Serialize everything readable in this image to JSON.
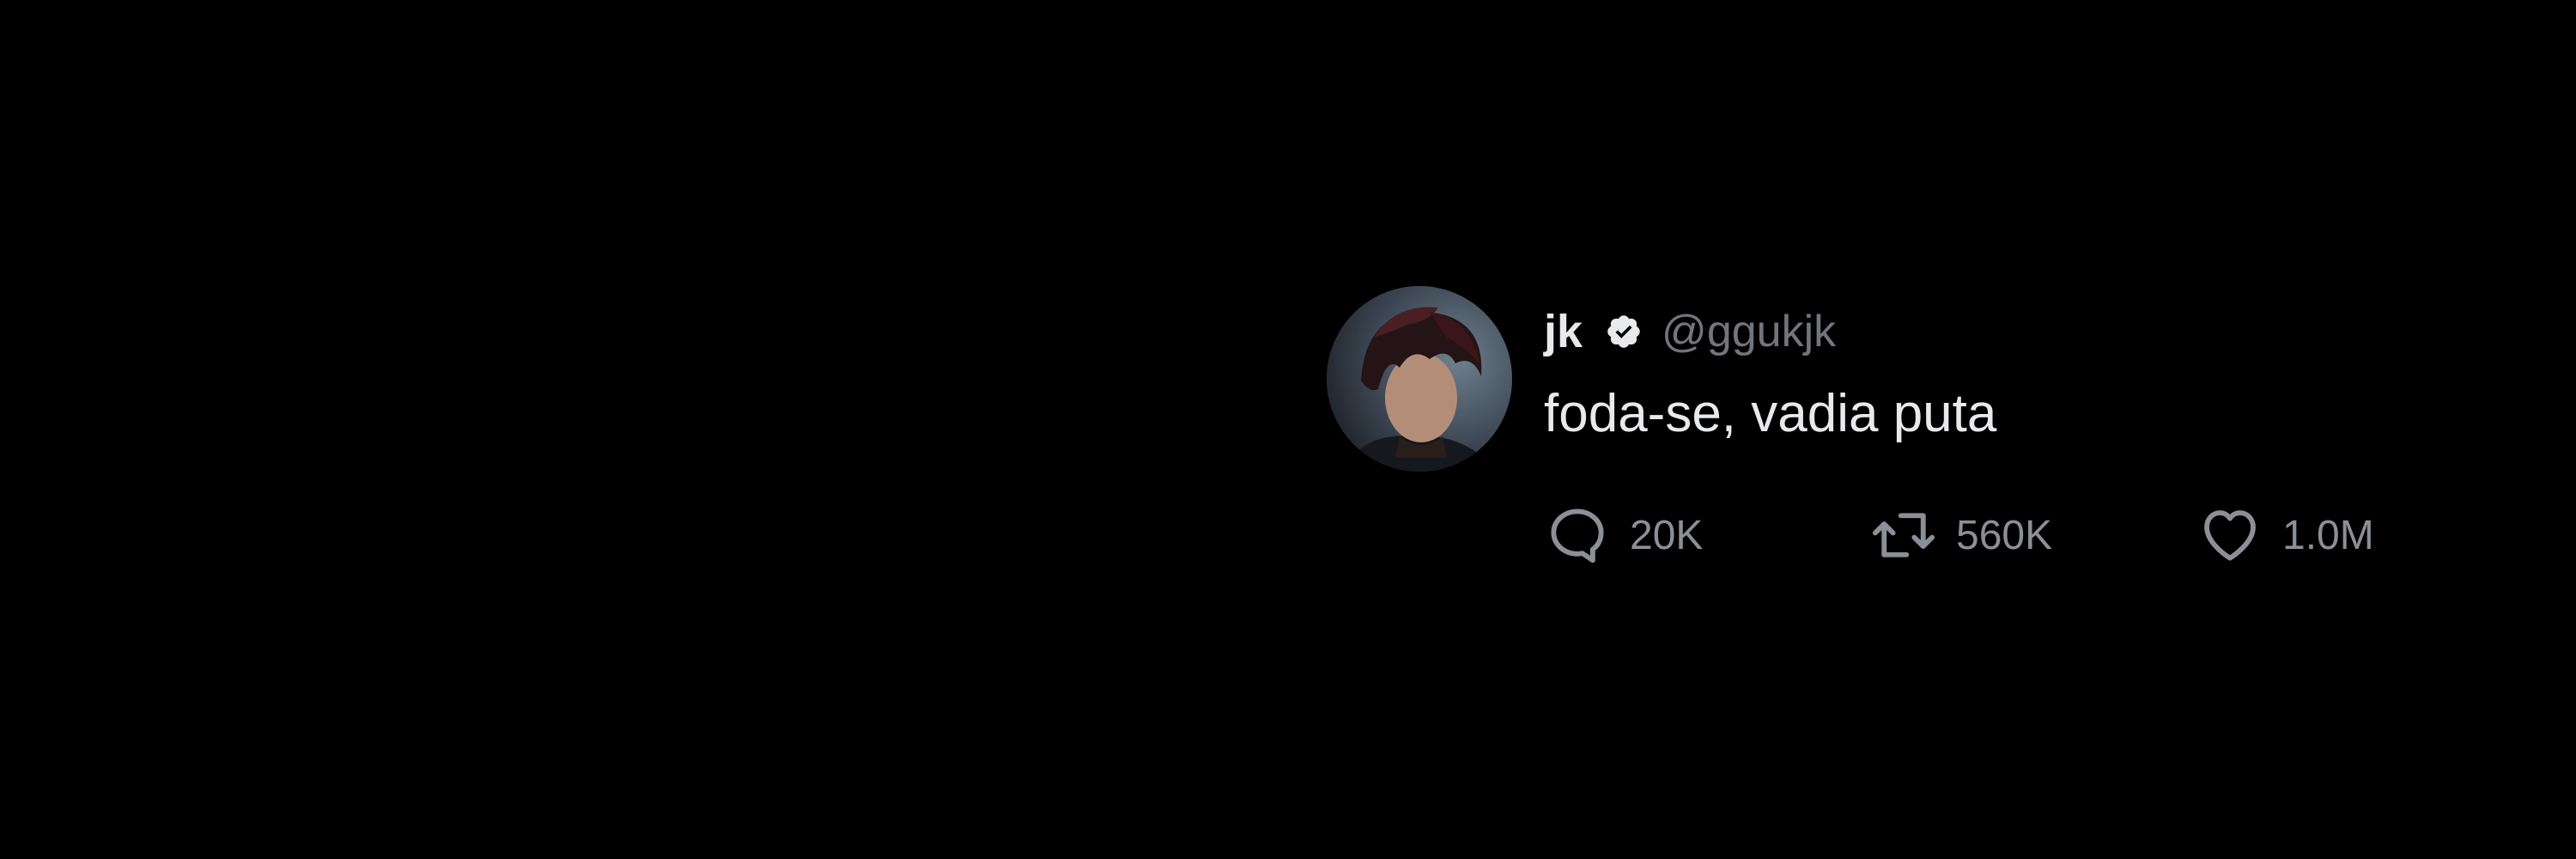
{
  "tweet": {
    "author": {
      "display_name": "jk",
      "handle": "@ggukjk",
      "verified": true
    },
    "text": "foda-se, vadia puta",
    "stats": {
      "replies": "20K",
      "retweets": "560K",
      "likes": "1.0M"
    }
  },
  "icons": {
    "verified": "verified-badge-icon",
    "reply": "speech-bubble-icon",
    "retweet": "retweet-arrows-icon",
    "like": "heart-icon"
  },
  "colors": {
    "background": "#000000",
    "primary_text": "#e7e9ea",
    "secondary_text": "#71767b",
    "action_text": "#8b9096"
  }
}
